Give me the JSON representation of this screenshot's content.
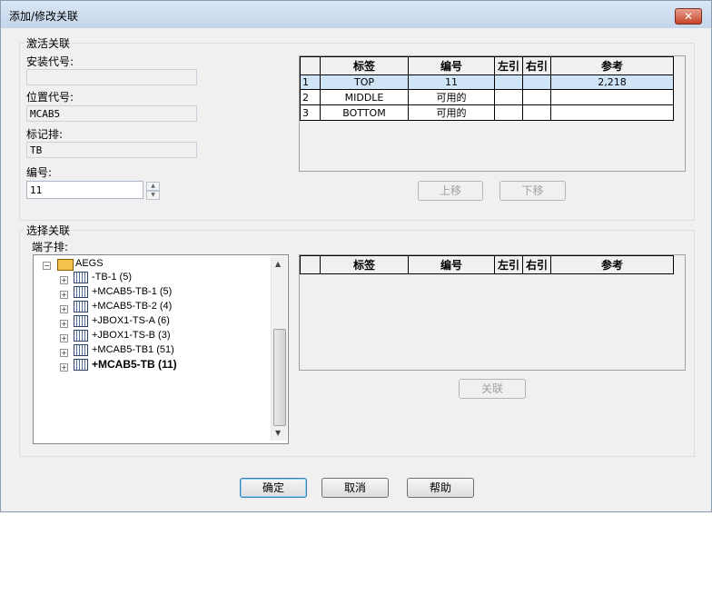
{
  "window": {
    "title": "添加/修改关联",
    "close_label": "✕"
  },
  "active": {
    "group_label": "激活关联",
    "install_code_label": "安装代号:",
    "install_code_value": "",
    "location_code_label": "位置代号:",
    "location_code_value": "MCAB5",
    "tag_label": "标记排:",
    "tag_value": "TB",
    "number_label": "编号:",
    "number_value": "11",
    "grid": {
      "headers": [
        "标签",
        "编号",
        "左引",
        "右引",
        "参考"
      ],
      "rows": [
        {
          "index": "1",
          "label": "TOP",
          "number": "11",
          "left": "",
          "right": "",
          "ref": "2,218"
        },
        {
          "index": "2",
          "label": "MIDDLE",
          "number": "可用的",
          "left": "",
          "right": "",
          "ref": ""
        },
        {
          "index": "3",
          "label": "BOTTOM",
          "number": "可用的",
          "left": "",
          "right": "",
          "ref": ""
        }
      ]
    },
    "move_up": "上移",
    "move_down": "下移"
  },
  "select": {
    "group_label": "选择关联",
    "strip_label": "端子排:",
    "tree": {
      "root": "AEGS",
      "items": [
        "-TB-1 (5)",
        "+MCAB5-TB-1 (5)",
        "+MCAB5-TB-2 (4)",
        "+JBOX1-TS-A (6)",
        "+JBOX1-TS-B (3)",
        "+MCAB5-TB1 (51)",
        "+MCAB5-TB (11)"
      ]
    },
    "grid": {
      "headers": [
        "标签",
        "编号",
        "左引",
        "右引",
        "参考"
      ]
    },
    "link": "关联"
  },
  "footer": {
    "ok": "确定",
    "cancel": "取消",
    "help": "帮助"
  }
}
